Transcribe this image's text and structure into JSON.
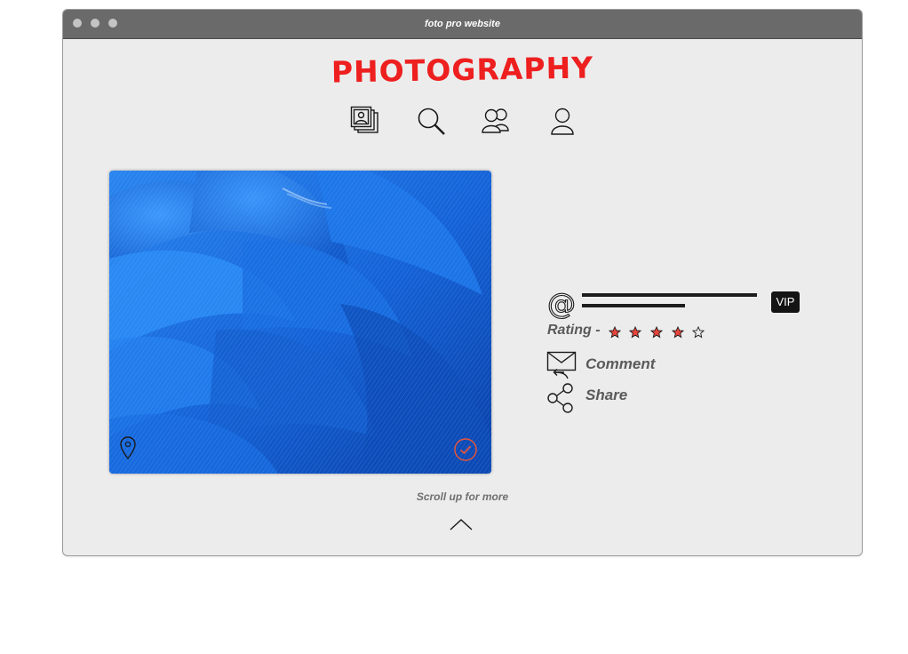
{
  "window": {
    "title": "foto pro website"
  },
  "header": {
    "logo": "PHOTOGRAPHY"
  },
  "nav": {
    "items": [
      {
        "icon": "photo-gallery-icon"
      },
      {
        "icon": "search-icon"
      },
      {
        "icon": "users-icon"
      },
      {
        "icon": "user-icon"
      }
    ]
  },
  "photo": {
    "location_icon": "map-pin-icon",
    "select_icon": "check-circle-icon",
    "accent_color": "#e2553e"
  },
  "profile": {
    "at_icon": "at-icon",
    "badge": "VIP",
    "rating_label": "Rating -",
    "rating_value": 4,
    "rating_max": 5,
    "star_color": "#e8453c"
  },
  "actions": {
    "comment_label": "Comment",
    "comment_icon": "mail-reply-icon",
    "share_label": "Share",
    "share_icon": "share-icon"
  },
  "footer": {
    "scroll_text": "Scroll up for more",
    "scroll_icon": "chevron-up-icon"
  },
  "colors": {
    "brand": "#ee1f1f",
    "titlebar": "#6a6a6a",
    "window_bg": "#ececec",
    "photo_blue": "#1566d8"
  }
}
